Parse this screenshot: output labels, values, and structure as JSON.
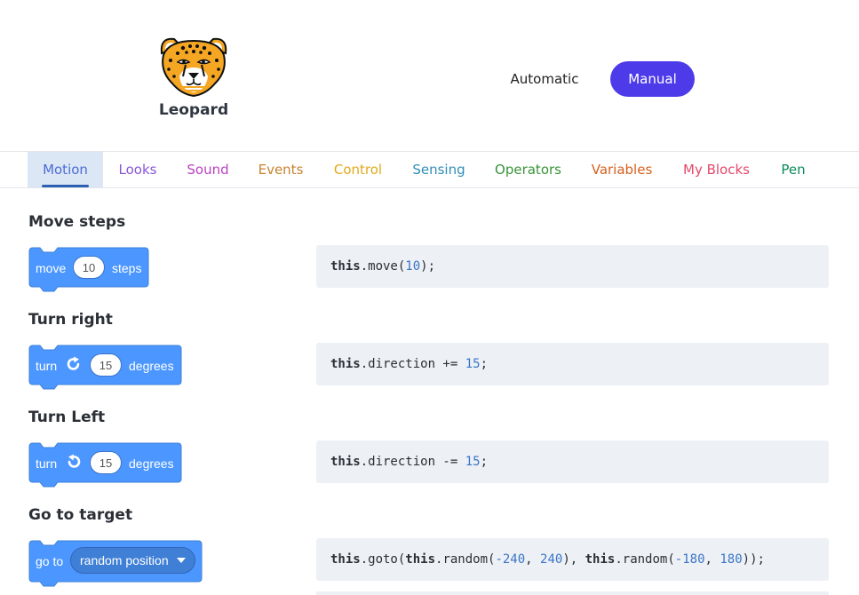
{
  "header": {
    "brand": "Leopard",
    "modes": {
      "automatic": "Automatic",
      "manual": "Manual"
    }
  },
  "tabs": [
    {
      "label": "Motion",
      "color": "#4a6cd4"
    },
    {
      "label": "Looks",
      "color": "#8a55d7"
    },
    {
      "label": "Sound",
      "color": "#bb42c3"
    },
    {
      "label": "Events",
      "color": "#c88330"
    },
    {
      "label": "Control",
      "color": "#e1a91a"
    },
    {
      "label": "Sensing",
      "color": "#2e8eb8"
    },
    {
      "label": "Operators",
      "color": "#389438"
    },
    {
      "label": "Variables",
      "color": "#d65f1e"
    },
    {
      "label": "My Blocks",
      "color": "#e5486a"
    },
    {
      "label": "Pen",
      "color": "#0e8a5a"
    }
  ],
  "sections": [
    {
      "title": "Move steps",
      "block": {
        "word1": "move",
        "value": "10",
        "word2": "steps"
      },
      "code": {
        "a": "this",
        "b": ".move(",
        "n1": "10",
        "c": ");"
      }
    },
    {
      "title": "Turn right",
      "block": {
        "word1": "turn",
        "icon": "rotate-right-icon",
        "value": "15",
        "word2": "degrees"
      },
      "code": {
        "a": "this",
        "b": ".direction += ",
        "n1": "15",
        "c": ";"
      }
    },
    {
      "title": "Turn Left",
      "block": {
        "word1": "turn",
        "icon": "rotate-left-icon",
        "value": "15",
        "word2": "degrees"
      },
      "code": {
        "a": "this",
        "b": ".direction -= ",
        "n1": "15",
        "c": ";"
      }
    },
    {
      "title": "Go to target",
      "block": {
        "word1": "go to",
        "dropdown": "random position"
      },
      "code": {
        "a": "this",
        "b": ".goto(",
        "a2": "this",
        "b2": ".random(",
        "n1": "-240",
        "s1": ", ",
        "n2": "240",
        "b3": "), ",
        "a3": "this",
        "b4": ".random(",
        "n3": "-180",
        "s2": ", ",
        "n4": "180",
        "c": "));"
      }
    }
  ],
  "colors": {
    "accent": "#4d3bea",
    "block_blue": "#4c97ff",
    "code_bg": "#edf1f5",
    "number": "#3a74c7"
  }
}
